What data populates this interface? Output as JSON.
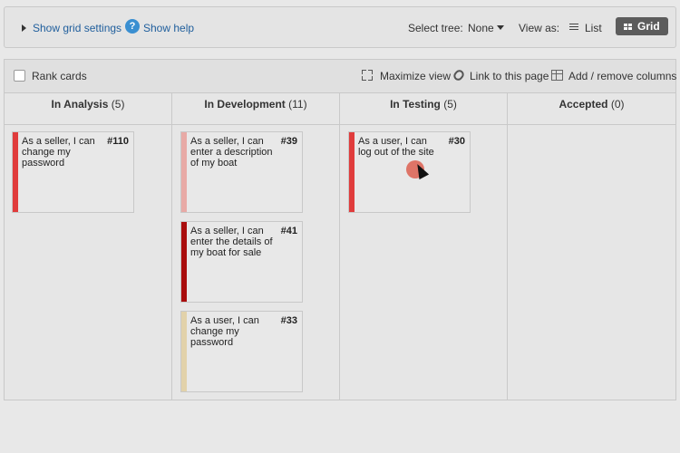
{
  "topbar": {
    "show_grid_settings": "Show grid settings",
    "show_help": "Show help",
    "help_icon_glyph": "?",
    "select_tree_label": "Select tree:",
    "select_tree_value": "None",
    "view_as_label": "View as:",
    "view_list": "List",
    "view_grid": "Grid",
    "active_view": "Grid"
  },
  "board_toolbar": {
    "rank_cards": "Rank cards",
    "rank_cards_checked": false,
    "maximize_view": "Maximize view",
    "link_to_page": "Link to this page",
    "add_remove_columns": "Add / remove columns"
  },
  "columns": [
    {
      "name": "In Analysis",
      "count": "(5)"
    },
    {
      "name": "In Development",
      "count": "(11)"
    },
    {
      "name": "In Testing",
      "count": "(5)"
    },
    {
      "name": "Accepted",
      "count": "(0)"
    }
  ],
  "cards": [
    {
      "title": "As a seller, I can change my password",
      "id": "#110",
      "color": "#e03c3c"
    },
    {
      "title": "As a seller, I can enter a description of my boat",
      "id": "#39",
      "color": "#e8aaa6"
    },
    {
      "title": "As a seller, I can enter the details of my boat for sale",
      "id": "#41",
      "color": "#a90d0d"
    },
    {
      "title": "As a user, I can change my password",
      "id": "#33",
      "color": "#e2d2aa"
    },
    {
      "title": "As a user, I can log out of the site",
      "id": "#30",
      "color": "#e03c3c"
    }
  ],
  "colors": {
    "link_blue": "#1f5e9c",
    "grid_button_bg": "#5c5c5c",
    "help_icon_bg": "#3a8fd1",
    "cursor_highlight": "#dc5f50"
  }
}
